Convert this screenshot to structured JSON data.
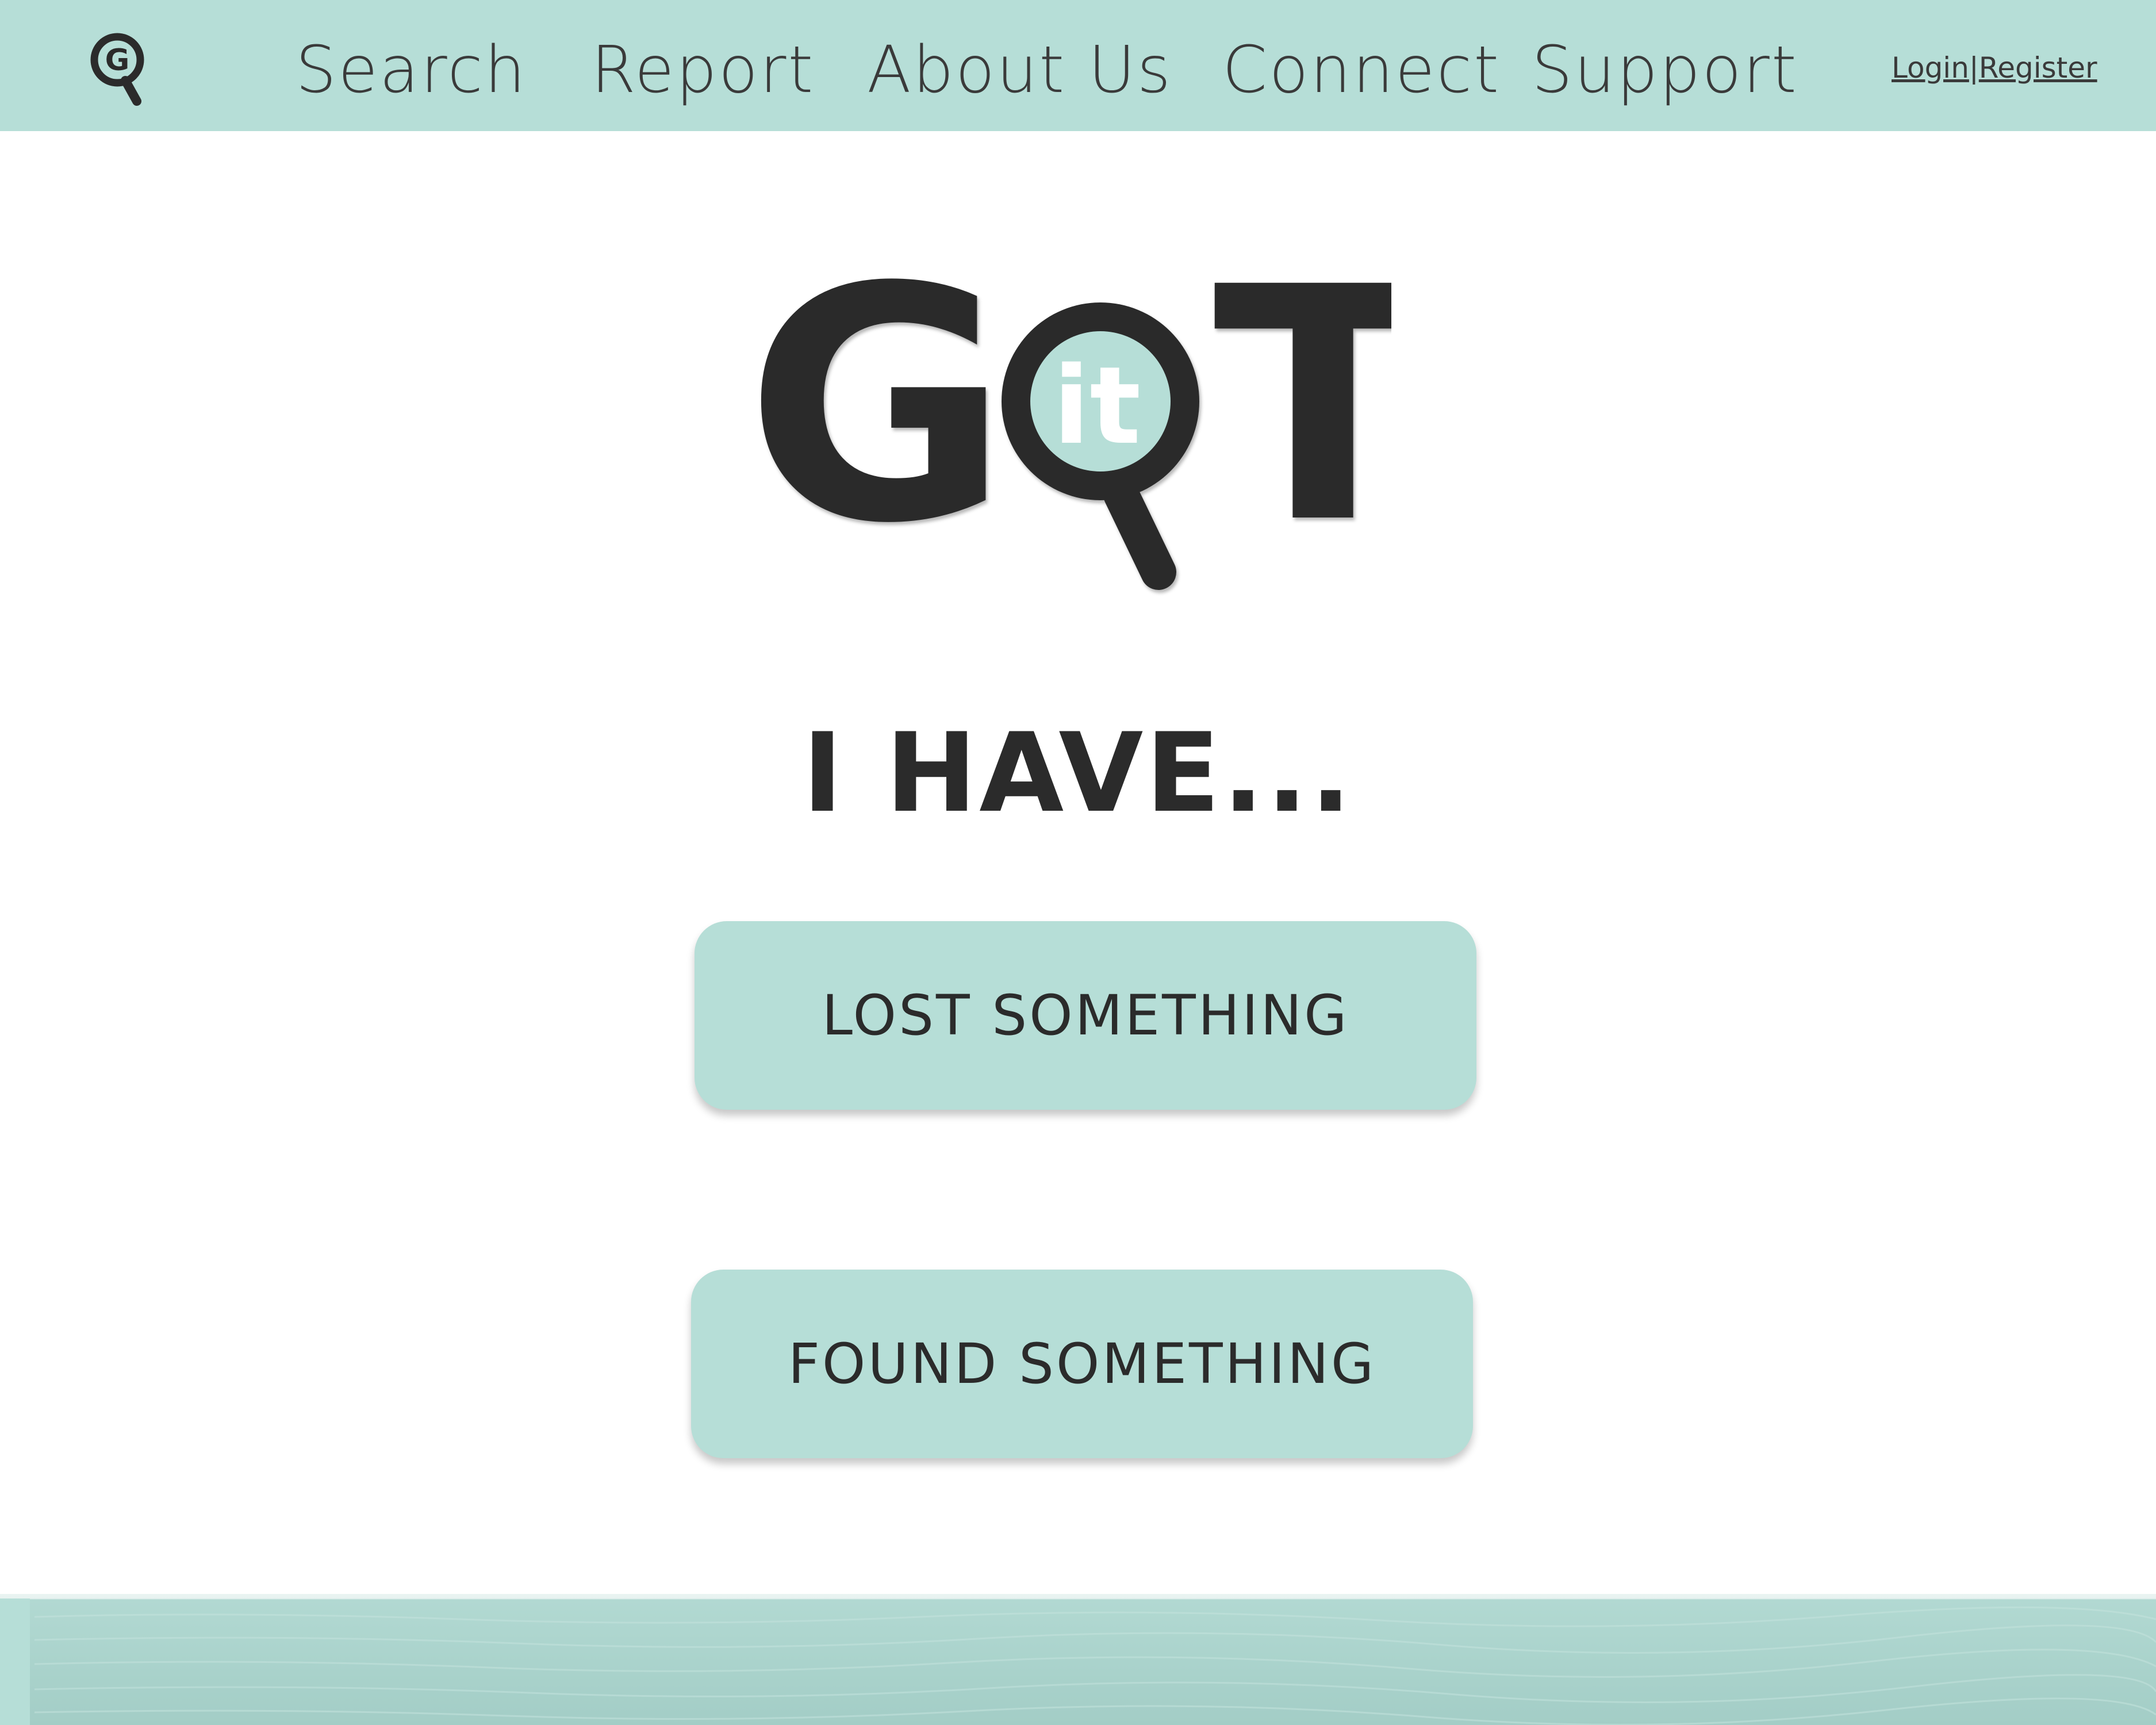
{
  "nav": {
    "items": [
      "Search",
      "Report",
      "About Us",
      "Connect",
      "Support"
    ],
    "login": "Login",
    "separator": "|",
    "register": "Register",
    "logo_icon": "magnifier-g-icon"
  },
  "brand": {
    "logo_text_left": "G",
    "logo_text_lens": "it",
    "logo_text_right": "T"
  },
  "main": {
    "heading": "I HAVE...",
    "lost_button": "LOST SOMETHING",
    "found_button": "FOUND SOMETHING"
  },
  "colors": {
    "accent": "#b6ded7",
    "text": "#2b2b2b",
    "background": "#ffffff"
  }
}
